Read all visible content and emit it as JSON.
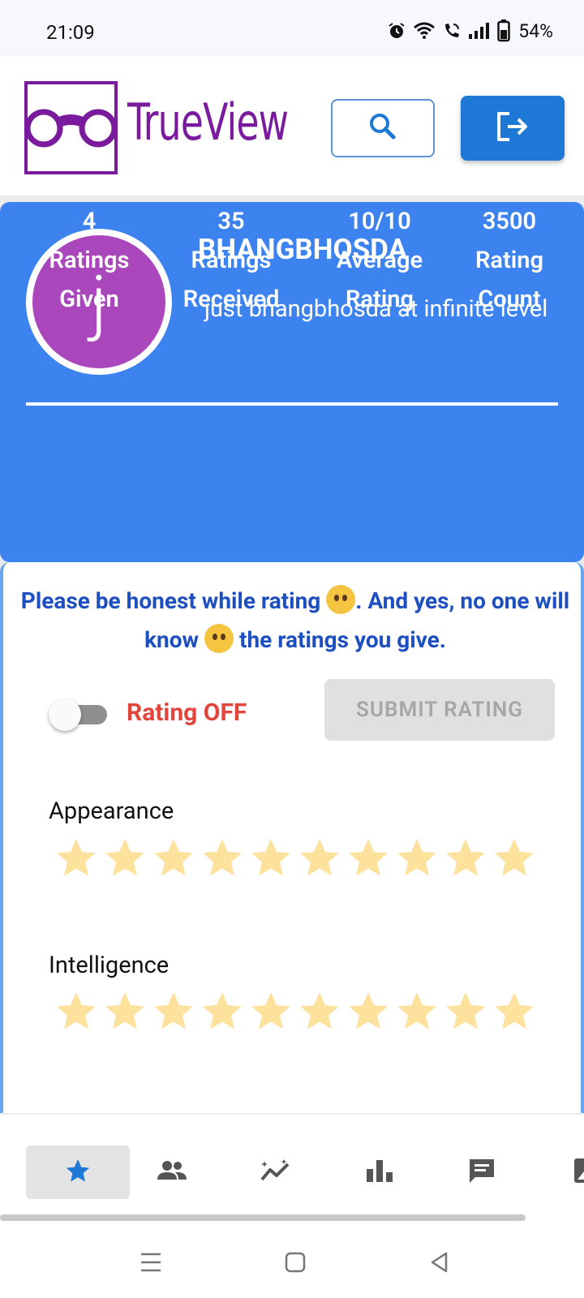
{
  "status_bar": {
    "time": "21:09",
    "battery_percent": "54%",
    "icons": [
      "alarm-icon",
      "wifi-icon",
      "wifi-call-icon",
      "signal-icon",
      "battery-icon"
    ]
  },
  "header": {
    "brand": "TrueView",
    "logo": "glasses-logo-icon",
    "search_icon": "search-icon",
    "logout_icon": "logout-icon",
    "brand_color": "#7a1b9e",
    "primary_color": "#1e78d6"
  },
  "profile": {
    "avatar_letter": "j",
    "avatar_color": "#ab47bc",
    "username": "BHANGBHOSDA",
    "bio": "just bhangbhosda at infinite level",
    "card_color": "#3d83ef",
    "stats": [
      {
        "value": "4",
        "line1": "Ratings",
        "line2": "Given"
      },
      {
        "value": "35",
        "line1": "Ratings",
        "line2": "Received"
      },
      {
        "value": "10/10",
        "line1": "Average",
        "line2": "Rating"
      },
      {
        "value": "3500",
        "line1": "Rating",
        "line2": "Count"
      }
    ]
  },
  "rating_panel": {
    "notice_part1": "Please be honest while rating ",
    "notice_part2": ". And yes, no one will know ",
    "notice_part3": " the ratings you give.",
    "toggle_state": "off",
    "toggle_label": "Rating OFF",
    "submit_label": "SUBMIT RATING",
    "star_color": "#fde29e",
    "categories": [
      {
        "label": "Appearance",
        "stars": 10
      },
      {
        "label": "Intelligence",
        "stars": 10
      }
    ]
  },
  "bottom_nav": {
    "items": [
      "star-icon",
      "people-icon",
      "trending-icon",
      "bar-chart-icon",
      "chat-icon",
      "image-icon"
    ],
    "active": "star-icon"
  },
  "system_nav": [
    "menu-icon",
    "home-icon",
    "back-icon"
  ]
}
